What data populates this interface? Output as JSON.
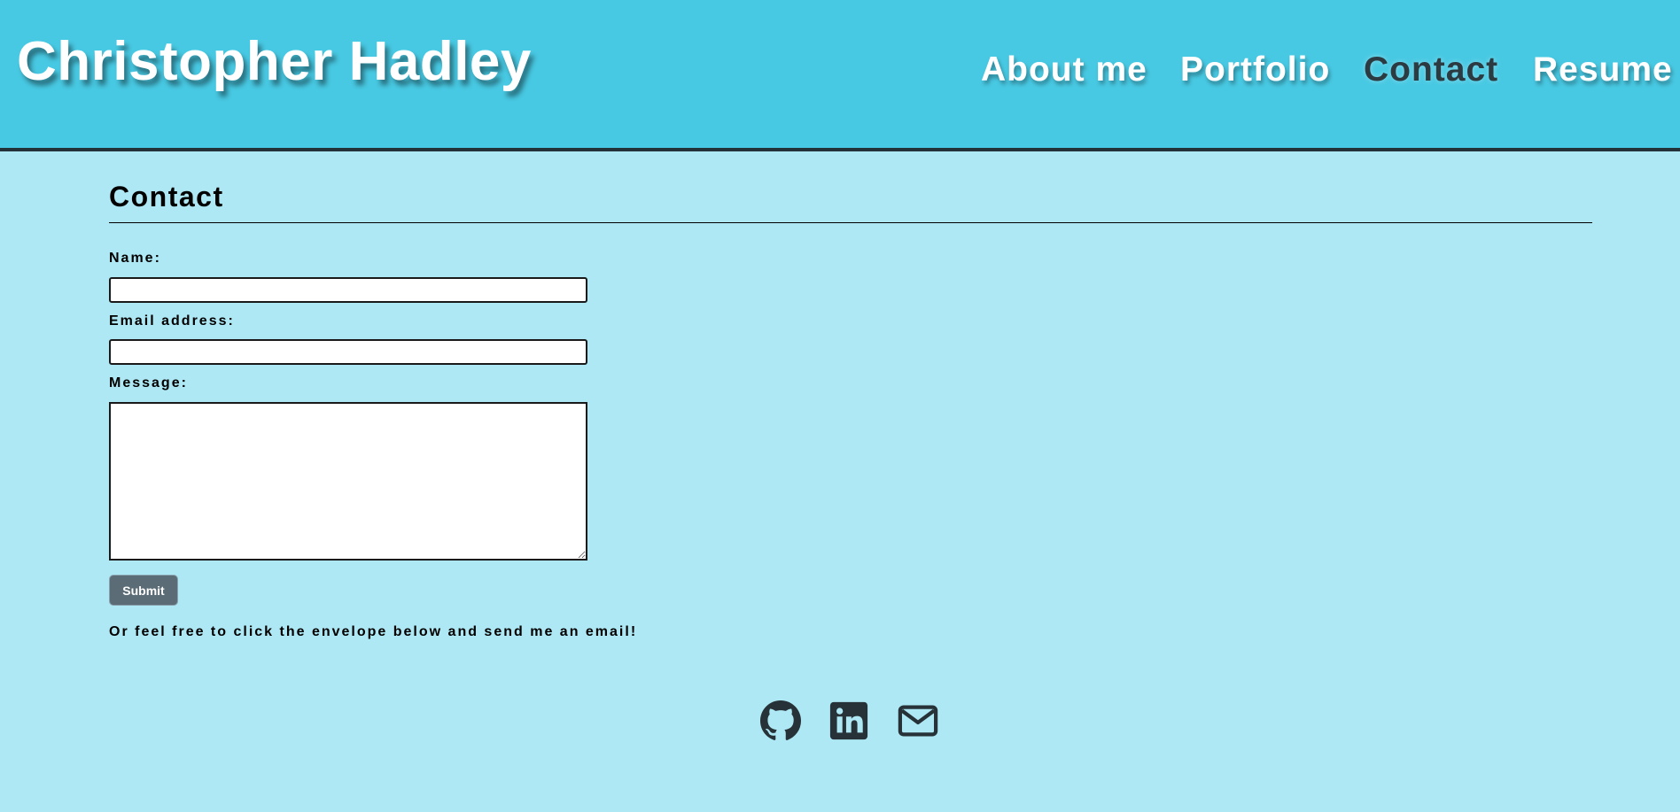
{
  "header": {
    "site_title": "Christopher Hadley",
    "nav": [
      {
        "label": "About me",
        "active": false
      },
      {
        "label": "Portfolio",
        "active": false
      },
      {
        "label": "Contact",
        "active": true
      },
      {
        "label": "Resume",
        "active": false
      }
    ]
  },
  "contact": {
    "title": "Contact",
    "form": {
      "name_label": "Name:",
      "name_value": "",
      "email_label": "Email address:",
      "email_value": "",
      "message_label": "Message:",
      "message_value": "",
      "submit_label": "Submit"
    },
    "note": "Or feel free to click the envelope below and send me an email!"
  },
  "footer": {
    "icons": [
      "github-icon",
      "linkedin-icon",
      "envelope-icon"
    ]
  },
  "colors": {
    "header_bg": "#48c9e3",
    "page_bg": "#aee8f4",
    "active_nav": "#2c3a42",
    "icon": "#263238",
    "button_bg": "#5b6c76"
  }
}
